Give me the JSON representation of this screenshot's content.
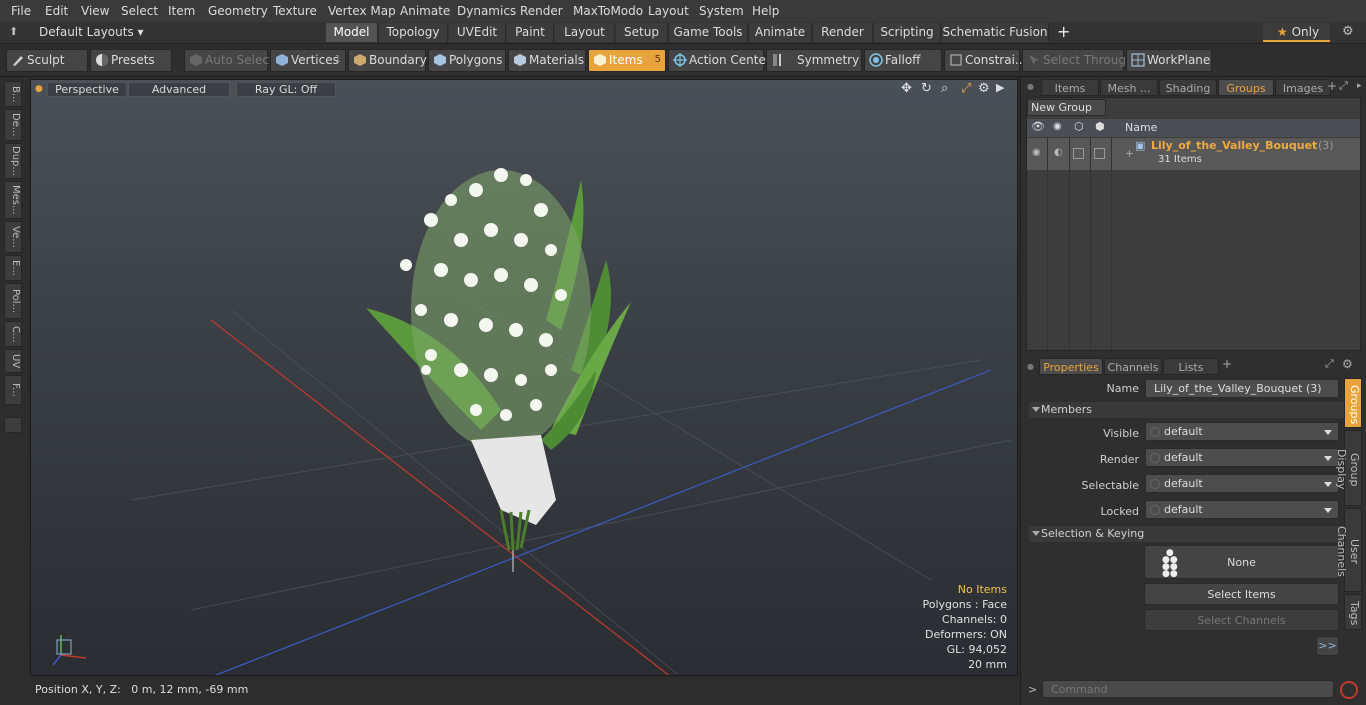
{
  "menu": [
    "File",
    "Edit",
    "View",
    "Select",
    "Item",
    "Geometry",
    "Texture",
    "Vertex Map",
    "Animate",
    "Dynamics",
    "Render",
    "MaxToModo",
    "Layout",
    "System",
    "Help"
  ],
  "layouts": {
    "label": "Default Layouts ▾"
  },
  "mode_tabs": [
    "Model",
    "Topology",
    "UVEdit",
    "Paint",
    "Layout",
    "Setup",
    "Game Tools",
    "Animate",
    "Render",
    "Scripting",
    "Schematic Fusion"
  ],
  "mode_tabs_active": "Model",
  "only_button": "Only",
  "toolbar": {
    "sculpt": "Sculpt",
    "presets": "Presets",
    "auto_select": "Auto Select",
    "vertices": "Vertices",
    "vertices_count": "1",
    "boundary": "Boundary",
    "polygons": "Polygons",
    "materials": "Materials",
    "items": "Items",
    "items_count": "5",
    "action_center": "Action Center",
    "symmetry": "Symmetry",
    "falloff": "Falloff",
    "constraints": "Constrai...",
    "select_through": "Select Through",
    "workplane": "WorkPlane"
  },
  "left_tabs": [
    "B...",
    "De...",
    "Dup...",
    "Mes...",
    "Ve...",
    "E...",
    "Pol...",
    "C...",
    "UV",
    "F..."
  ],
  "viewport": {
    "perspective": "Perspective",
    "advanced": "Advanced",
    "raygl": "Ray GL: Off",
    "stats": {
      "no_items": "No Items",
      "polygons": "Polygons : Face",
      "channels": "Channels: 0",
      "deformers": "Deformers: ON",
      "gl": "GL: 94,052",
      "scale": "20 mm"
    }
  },
  "status": {
    "position": "Position X, Y, Z:   0 m, 12 mm, -69 mm"
  },
  "right_tabs": [
    "Items",
    "Mesh ...",
    "Shading",
    "Groups",
    "Images"
  ],
  "right_tabs_active": "Groups",
  "groups": {
    "new_group": "New Group",
    "col_name": "Name",
    "row_name": "Lily_of_the_Valley_Bouquet",
    "row_count": "(3)",
    "row_items": "31 Items"
  },
  "props_tabs": [
    "Properties",
    "Channels",
    "Lists"
  ],
  "props": {
    "name_label": "Name",
    "name_value": "Lily_of_the_Valley_Bouquet (3)",
    "members": "Members",
    "visible_label": "Visible",
    "visible_value": "default",
    "render_label": "Render",
    "render_value": "default",
    "selectable_label": "Selectable",
    "selectable_value": "default",
    "locked_label": "Locked",
    "locked_value": "default",
    "sel_keying": "Selection & Keying",
    "none": "None",
    "select_items": "Select Items",
    "select_channels": "Select Channels",
    "more": ">>"
  },
  "side_vtabs": [
    "Groups",
    "Group Display",
    "User Channels",
    "Tags"
  ],
  "command": {
    "placeholder": "Command"
  },
  "colors": {
    "accent": "#e8a33c",
    "x_axis": "#c0392b",
    "z_axis": "#3a5bc7"
  }
}
